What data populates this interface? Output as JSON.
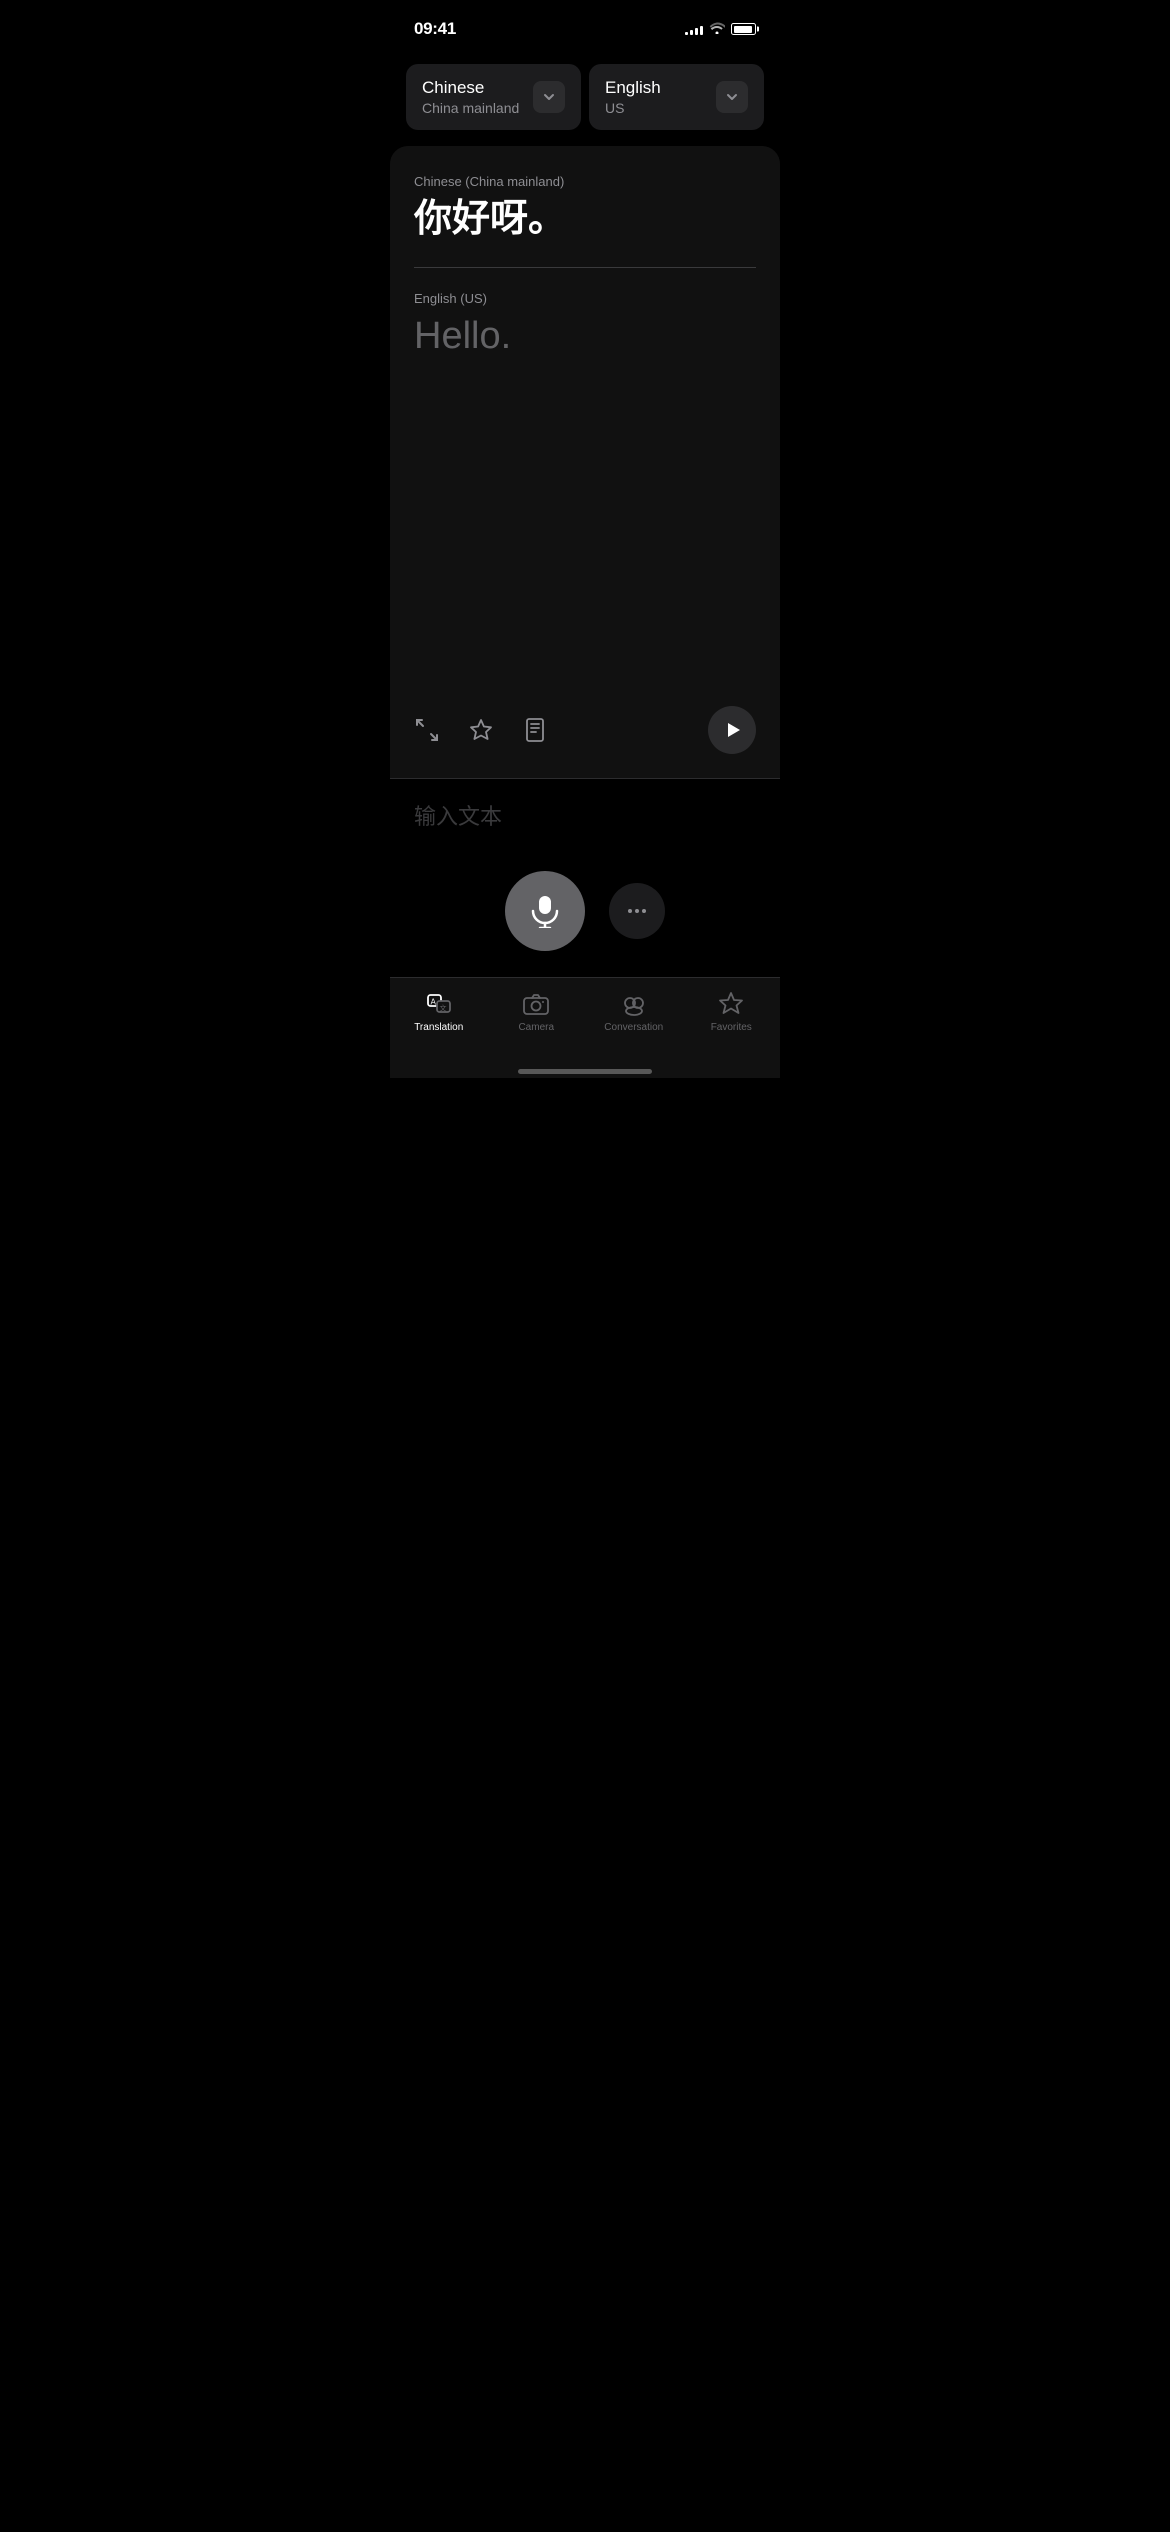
{
  "status": {
    "time": "09:41",
    "signal_bars": [
      3,
      5,
      7,
      9,
      11
    ],
    "wifi": "wifi",
    "battery": 90
  },
  "languages": {
    "source": {
      "name": "Chinese",
      "region": "China mainland"
    },
    "target": {
      "name": "English",
      "region": "US"
    }
  },
  "translation": {
    "source_label": "Chinese (China mainland)",
    "source_text": "你好呀。",
    "target_label": "English (US)",
    "target_text": "Hello."
  },
  "input": {
    "placeholder": "输入文本"
  },
  "tabs": {
    "translation": "Translation",
    "camera": "Camera",
    "conversation": "Conversation",
    "favorites": "Favorites"
  }
}
